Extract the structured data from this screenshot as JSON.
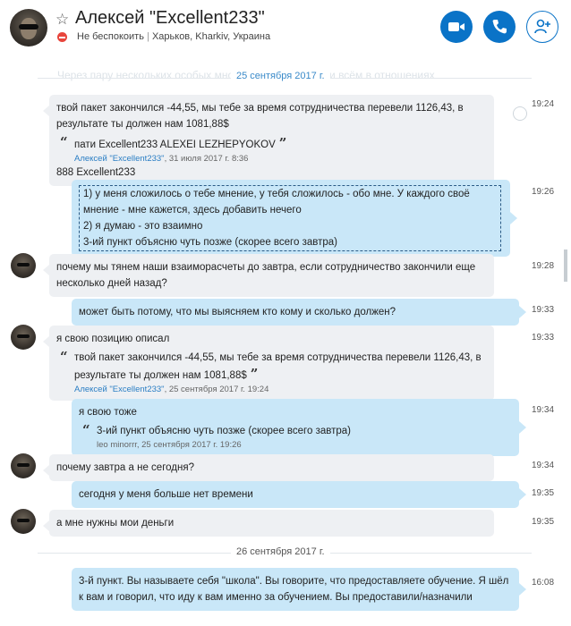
{
  "header": {
    "contact_name": "Алексей \"Excellent233\"",
    "status_text": "Не беспокоить",
    "location": "Харьков, Kharkiv, Украина",
    "separator": "|",
    "icons": [
      "star-icon",
      "do-not-disturb-icon",
      "video-call-icon",
      "audio-call-icon",
      "add-people-icon"
    ],
    "accent_color": "#0a73c7"
  },
  "chat": {
    "faded_text": "Через пару нескольких особых много тебе не будет при всём в отношениях",
    "dates": [
      "25 сентября 2017 г.",
      "26 сентября 2017 г."
    ],
    "messages": [
      {
        "direction": "in",
        "text": "твой пакет закончился -44,55, мы тебе за время сотрудничества перевели 1126,43, в результате ты должен нам 1081,88$",
        "quote_text": "пати Excellent233 ALEXEI LEZHEPYOKOV",
        "quote_author": "Алексей \"Excellent233\"",
        "quote_date": ", 31 июля 2017 г. 8:36",
        "after_text": "888  Excellent233",
        "time": "19:24"
      },
      {
        "direction": "out",
        "lines": [
          "1) у меня сложилось о тебе мнение, у тебя сложилось - обо мне. У каждого своё",
          "мнение - мне кажется, здесь добавить нечего",
          "2) я думаю - это взаимно",
          "3-ий пункт объясню чуть позже (скорее всего завтра)"
        ],
        "time": "19:26"
      },
      {
        "direction": "in",
        "text": "почему мы тянем наши взаиморасчеты до завтра, если сотрудничество закончили еще несколько дней назад?",
        "time": "19:28"
      },
      {
        "direction": "out",
        "text": "может быть потому, что мы выясняем кто кому и сколько должен?",
        "time": "19:33"
      },
      {
        "direction": "in",
        "text": "я свою позицию описал",
        "quote_text": "твой пакет закончился -44,55, мы тебе за время сотрудничества перевели 1126,43, в результате ты должен нам 1081,88$",
        "quote_author": "Алексей \"Excellent233\"",
        "quote_date": ", 25 сентября 2017 г. 19:24",
        "time": "19:33"
      },
      {
        "direction": "out",
        "text": "я свою тоже",
        "quote_text": "3-ий пункт объясню чуть позже (скорее всего завтра)",
        "quote_meta": "leo minorrr, 25 сентября 2017 г. 19:26",
        "time": "19:34"
      },
      {
        "direction": "in",
        "text": "почему завтра а не сегодня?",
        "time": "19:34"
      },
      {
        "direction": "out",
        "text": "сегодня у меня больше нет времени",
        "time": "19:35"
      },
      {
        "direction": "in",
        "text": "а мне нужны мои деньги",
        "time": "19:35"
      },
      {
        "direction": "out",
        "text": "3-й пункт. Вы называете себя \"школа\". Вы говорите, что предоставляете обучение. Я шёл к вам и говорил, что иду к вам именно за обучением. Вы предоставили/назначили",
        "time": "16:08"
      }
    ]
  }
}
